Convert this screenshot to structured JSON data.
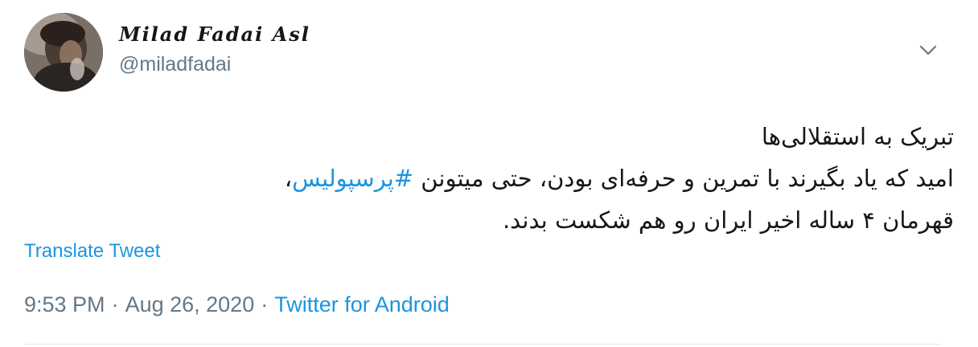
{
  "author": {
    "display_name": "Milad Fadai Asl",
    "handle": "@miladfadai"
  },
  "menu": {
    "icon": "chevron-down-icon"
  },
  "tweet": {
    "line1": "تبریک به استقلالی‌ها",
    "line2_before": "امید که یاد بگیرند با تمرین و حرفه‌ای بودن، حتی میتونن ",
    "hashtag": "#پرسپولیس",
    "line2_after": "،",
    "line3": "قهرمان ۴ ساله اخیر ایران رو هم شکست بدند."
  },
  "translate_label": "Translate Tweet",
  "meta": {
    "time": "9:53 PM",
    "separator": "·",
    "date": "Aug 26, 2020",
    "source": "Twitter for Android"
  },
  "colors": {
    "link": "#1b95e0",
    "secondary_text": "#657786",
    "primary_text": "#14171a",
    "divider": "#e1e8ed"
  }
}
